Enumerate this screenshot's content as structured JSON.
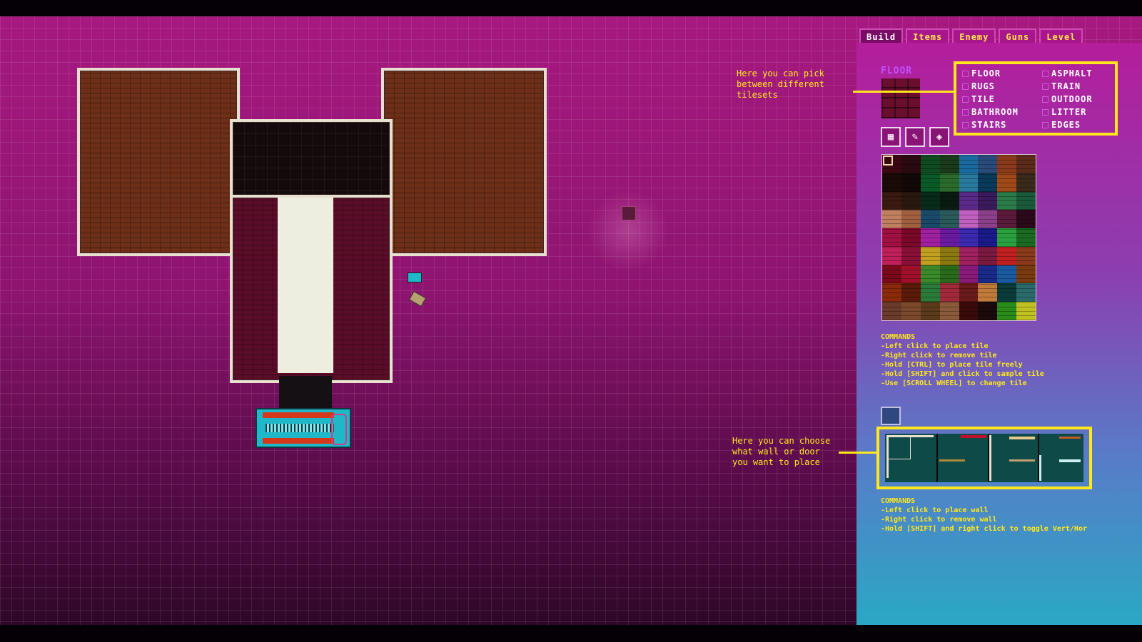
{
  "tabs": [
    "Build",
    "Items",
    "Enemy",
    "Guns",
    "Level"
  ],
  "active_tab": "Build",
  "floor_label": "FLOOR",
  "tilesets": [
    [
      "FLOOR",
      "ASPHALT"
    ],
    [
      "RUGS",
      "TRAIN"
    ],
    [
      "TILE",
      "OUTDOOR"
    ],
    [
      "BATHROOM",
      "LITTER"
    ],
    [
      "STAIRS",
      "EDGES"
    ]
  ],
  "tile_commands": {
    "title": "COMMANDS",
    "lines": [
      "-Left click to place tile",
      "-Right click to remove tile",
      "-Hold [CTRL] to place tile freely",
      "-Hold [SHIFT] and click to sample tile",
      "-Use [SCROLL WHEEL] to change tile"
    ]
  },
  "wall_commands": {
    "title": "COMMANDS",
    "lines": [
      "-Left click to place wall",
      "-Right click to remove wall",
      "-Hold [SHIFT] and right click to toggle Vert/Hor"
    ]
  },
  "annotations": {
    "tilesets": "Here you can pick\nbetween different\ntilesets",
    "walls": "Here you can choose\nwhat wall or door\nyou want to place"
  },
  "colors": {
    "accent": "#ffe81a",
    "panel_top": "#b41d9c",
    "panel_bottom": "#2aa8c4",
    "canvas": "#a6197f"
  },
  "tile_palette": [
    "#3a0812",
    "#2a0a10",
    "#0f4a20",
    "#1a3a1a",
    "#1a6aa0",
    "#2a4a7a",
    "#8a3a1a",
    "#5a2a1a",
    "#1a0a08",
    "#120808",
    "#0a5a28",
    "#2a6a2a",
    "#2a7aa0",
    "#0a3a5a",
    "#a04a1a",
    "#3a2a1a",
    "#3a1a10",
    "#2a1810",
    "#082a18",
    "#0a1a10",
    "#5a2a8a",
    "#3a1a5a",
    "#2a7a4a",
    "#1a5a3a",
    "#c08060",
    "#a06040",
    "#1a4a6a",
    "#2a5a5a",
    "#c060c0",
    "#8a408a",
    "#5a1a3a",
    "#2a0a1a",
    "#a01040",
    "#7a0828",
    "#a020a0",
    "#6a1aa0",
    "#3a2ab0",
    "#1a1a8a",
    "#2aa040",
    "#1a6a20",
    "#c0205a",
    "#8a1038",
    "#c0a020",
    "#8a7a10",
    "#a02060",
    "#7a1a40",
    "#c02020",
    "#8a3a1a",
    "#7a0a1a",
    "#a0102a",
    "#3a8a2a",
    "#2a6a1a",
    "#8a1a7a",
    "#1a2a8a",
    "#1a5aa0",
    "#7a3a10",
    "#8a2a0a",
    "#5a1a0a",
    "#2a7a3a",
    "#a02a3a",
    "#6a1a1a",
    "#c07a3a",
    "#0a3a3a",
    "#2a6a6a",
    "#6a3a2a",
    "#7a4a2a",
    "#5a3a1a",
    "#8a5a3a",
    "#3a0a0a",
    "#1a0a0a",
    "#2a8a1a",
    "#c0c020"
  ]
}
